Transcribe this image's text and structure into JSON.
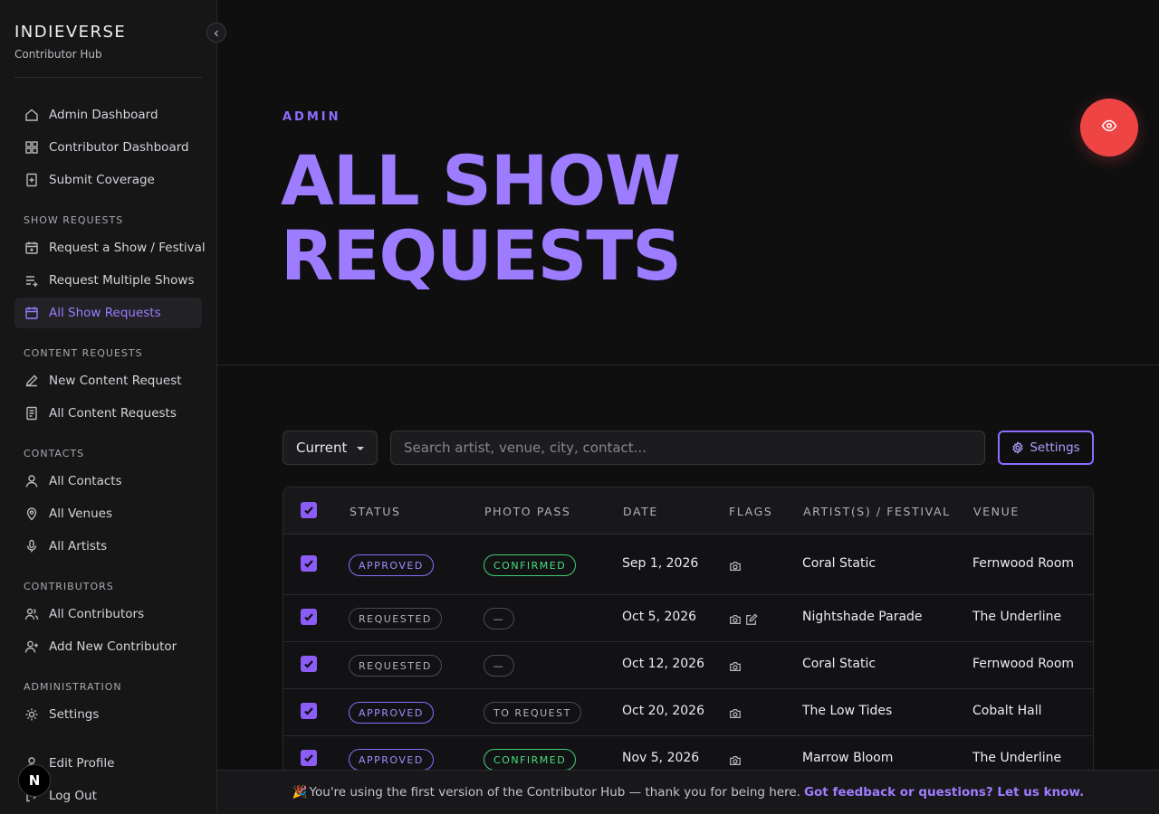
{
  "brand": {
    "title": "INDIEVERSE",
    "subtitle": "Contributor Hub"
  },
  "nav": {
    "top": [
      {
        "label": "Admin Dashboard",
        "icon": "home-icon"
      },
      {
        "label": "Contributor Dashboard",
        "icon": "grid-icon"
      },
      {
        "label": "Submit Coverage",
        "icon": "file-plus-icon"
      }
    ],
    "sections": [
      {
        "title": "SHOW REQUESTS",
        "items": [
          {
            "label": "Request a Show / Festival",
            "icon": "calendar-plus-icon"
          },
          {
            "label": "Request Multiple Shows",
            "icon": "list-plus-icon"
          },
          {
            "label": "All Show Requests",
            "icon": "calendar-icon",
            "active": true
          }
        ]
      },
      {
        "title": "CONTENT REQUESTS",
        "items": [
          {
            "label": "New Content Request",
            "icon": "pen-icon"
          },
          {
            "label": "All Content Requests",
            "icon": "document-icon"
          }
        ]
      },
      {
        "title": "CONTACTS",
        "items": [
          {
            "label": "All Contacts",
            "icon": "user-icon"
          },
          {
            "label": "All Venues",
            "icon": "map-pin-icon"
          },
          {
            "label": "All Artists",
            "icon": "mic-icon"
          }
        ]
      },
      {
        "title": "CONTRIBUTORS",
        "items": [
          {
            "label": "All Contributors",
            "icon": "users-icon"
          },
          {
            "label": "Add New Contributor",
            "icon": "user-plus-icon"
          }
        ]
      },
      {
        "title": "ADMINISTRATION",
        "items": [
          {
            "label": "Settings",
            "icon": "sun-gear-icon"
          }
        ]
      }
    ],
    "bottom": [
      {
        "label": "Edit Profile",
        "icon": "user-icon"
      },
      {
        "label": "Log Out",
        "icon": "logout-icon"
      }
    ]
  },
  "next_badge": "N",
  "hero": {
    "eyebrow": "ADMIN",
    "title_line1": "ALL SHOW",
    "title_line2": "REQUESTS"
  },
  "toolbar": {
    "filter_value": "Current",
    "search_placeholder": "Search artist, venue, city, contact...",
    "settings_label": "Settings"
  },
  "table": {
    "columns": [
      "STATUS",
      "PHOTO PASS",
      "DATE",
      "FLAGS",
      "ARTIST(S) / FESTIVAL",
      "VENUE"
    ],
    "rows": [
      {
        "status": "APPROVED",
        "photo_pass": "CONFIRMED",
        "date": "Sep 1, 2026",
        "flags": [
          "camera-icon"
        ],
        "artist": "Coral Static",
        "venue": "Fernwood Room"
      },
      {
        "status": "REQUESTED",
        "photo_pass": "—",
        "date": "Oct 5, 2026",
        "flags": [
          "camera-icon",
          "edit-icon"
        ],
        "artist": "Nightshade Parade",
        "venue": "The Underline"
      },
      {
        "status": "REQUESTED",
        "photo_pass": "—",
        "date": "Oct 12, 2026",
        "flags": [
          "camera-icon"
        ],
        "artist": "Coral Static",
        "venue": "Fernwood Room"
      },
      {
        "status": "APPROVED",
        "photo_pass": "TO REQUEST",
        "date": "Oct 20, 2026",
        "flags": [
          "camera-icon"
        ],
        "artist": "The Low Tides",
        "venue": "Cobalt Hall"
      },
      {
        "status": "APPROVED",
        "photo_pass": "CONFIRMED",
        "date": "Nov 5, 2026",
        "flags": [
          "camera-icon"
        ],
        "artist": "Marrow Bloom",
        "venue": "The Underline"
      }
    ]
  },
  "banner": {
    "emoji": "🎉",
    "text": "You're using the first version of the Contributor Hub — thank you for being here.",
    "link": "Got feedback or questions? Let us know."
  },
  "colors": {
    "accent": "#9d7cff",
    "fab": "#ef4444",
    "confirmed": "#4ade80"
  }
}
